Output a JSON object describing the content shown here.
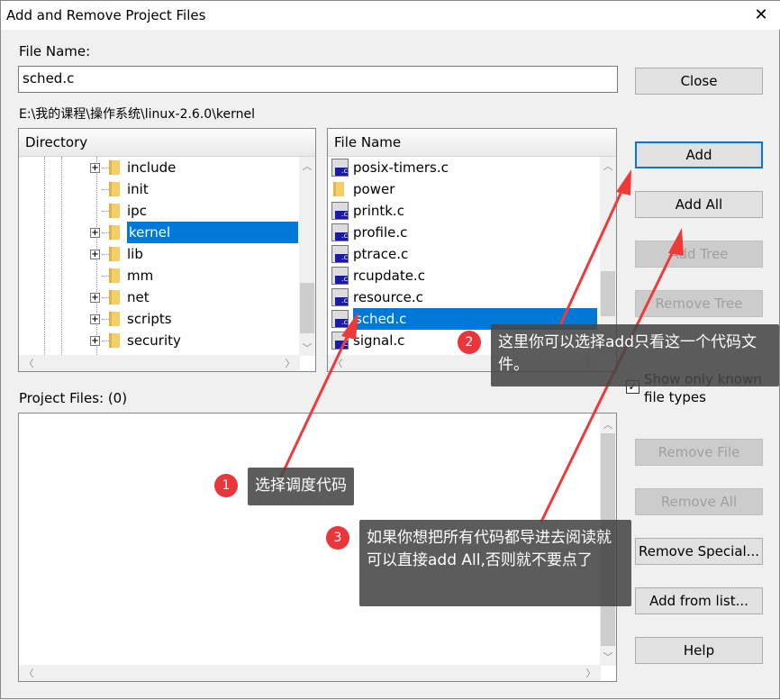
{
  "window": {
    "title": "Add and Remove Project Files",
    "close_glyph": "✕"
  },
  "file_name": {
    "label": "File Name:",
    "value": "sched.c"
  },
  "path": "E:\\我的课程\\操作系统\\linux-2.6.0\\kernel",
  "directory": {
    "header": "Directory",
    "items": [
      {
        "label": "include",
        "expandable": true
      },
      {
        "label": "init",
        "expandable": false
      },
      {
        "label": "ipc",
        "expandable": false
      },
      {
        "label": "kernel",
        "expandable": true,
        "selected": true
      },
      {
        "label": "lib",
        "expandable": true
      },
      {
        "label": "mm",
        "expandable": false
      },
      {
        "label": "net",
        "expandable": true
      },
      {
        "label": "scripts",
        "expandable": true
      },
      {
        "label": "security",
        "expandable": true
      }
    ]
  },
  "files": {
    "header": "File Name",
    "items": [
      {
        "label": "posix-timers.c",
        "type": "c-file"
      },
      {
        "label": "power",
        "type": "folder"
      },
      {
        "label": "printk.c",
        "type": "c-file"
      },
      {
        "label": "profile.c",
        "type": "c-file"
      },
      {
        "label": "ptrace.c",
        "type": "c-file"
      },
      {
        "label": "rcupdate.c",
        "type": "c-file"
      },
      {
        "label": "resource.c",
        "type": "c-file"
      },
      {
        "label": "sched.c",
        "type": "c-file",
        "selected": true
      },
      {
        "label": "signal.c",
        "type": "c-file"
      }
    ]
  },
  "buttons": {
    "close": "Close",
    "add": "Add",
    "add_all": "Add All",
    "add_tree": "Add Tree",
    "remove_tree": "Remove Tree",
    "remove_file": "Remove File",
    "remove_all": "Remove All",
    "remove_special": "Remove Special...",
    "add_from_list": "Add from list...",
    "help": "Help"
  },
  "checkbox": {
    "label": "Show only known file types",
    "checked": true
  },
  "project_files": {
    "label": "Project Files: (0)"
  },
  "annotations": [
    {
      "number": "1",
      "text": "选择调度代码"
    },
    {
      "number": "2",
      "text": "这里你可以选择add只看这一个代码文件。"
    },
    {
      "number": "3",
      "text": "如果你想把所有代码都导进去阅读就可以直接add All,否则就不要点了"
    }
  ],
  "colors": {
    "selection": "#0078d7",
    "annotation_arrow": "#f03a3a",
    "badge": "#e8363a"
  }
}
